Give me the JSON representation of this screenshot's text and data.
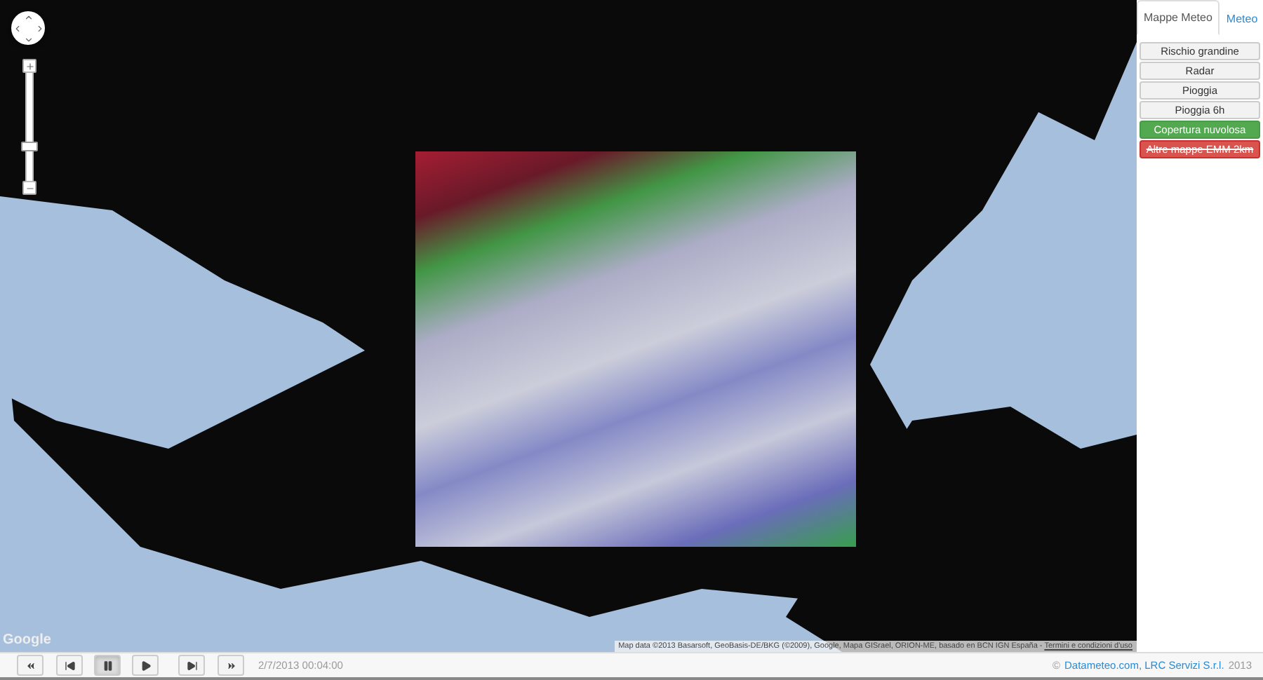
{
  "map": {
    "logo": "Google",
    "attribution": "Map data ©2013 Basarsoft, GeoBasis-DE/BKG (©2009), Google, Mapa GISrael, ORION-ME, basado en BCN IGN España - ",
    "terms_link": "Termini e condizioni d'uso",
    "zoom": {
      "level": 0.33
    }
  },
  "tabs": [
    {
      "label": "Mappe Meteo",
      "selected": true
    },
    {
      "label": "Meteo",
      "selected": false
    }
  ],
  "layers": [
    {
      "label": "Rischio grandine",
      "kind": "default",
      "struck": false
    },
    {
      "label": "Radar",
      "kind": "default",
      "struck": false
    },
    {
      "label": "Pioggia",
      "kind": "default",
      "struck": false
    },
    {
      "label": "Pioggia 6h",
      "kind": "default",
      "struck": false
    },
    {
      "label": "Copertura nuvolosa",
      "kind": "success",
      "struck": false
    },
    {
      "label": "Altre mappe EMM 2km",
      "kind": "danger",
      "struck": true
    }
  ],
  "player": {
    "buttons": [
      {
        "kind": "first",
        "selected": false
      },
      {
        "kind": "prev",
        "selected": false
      },
      {
        "kind": "pause",
        "selected": true
      },
      {
        "kind": "play",
        "selected": false
      },
      {
        "kind": "next",
        "selected": false
      },
      {
        "kind": "last",
        "selected": false
      }
    ],
    "timestamp": "2/7/2013 00:04:00"
  },
  "footer": {
    "symbol": "©",
    "link": "Datameteo.com, LRC Servizi S.r.l.",
    "year": "2013"
  }
}
